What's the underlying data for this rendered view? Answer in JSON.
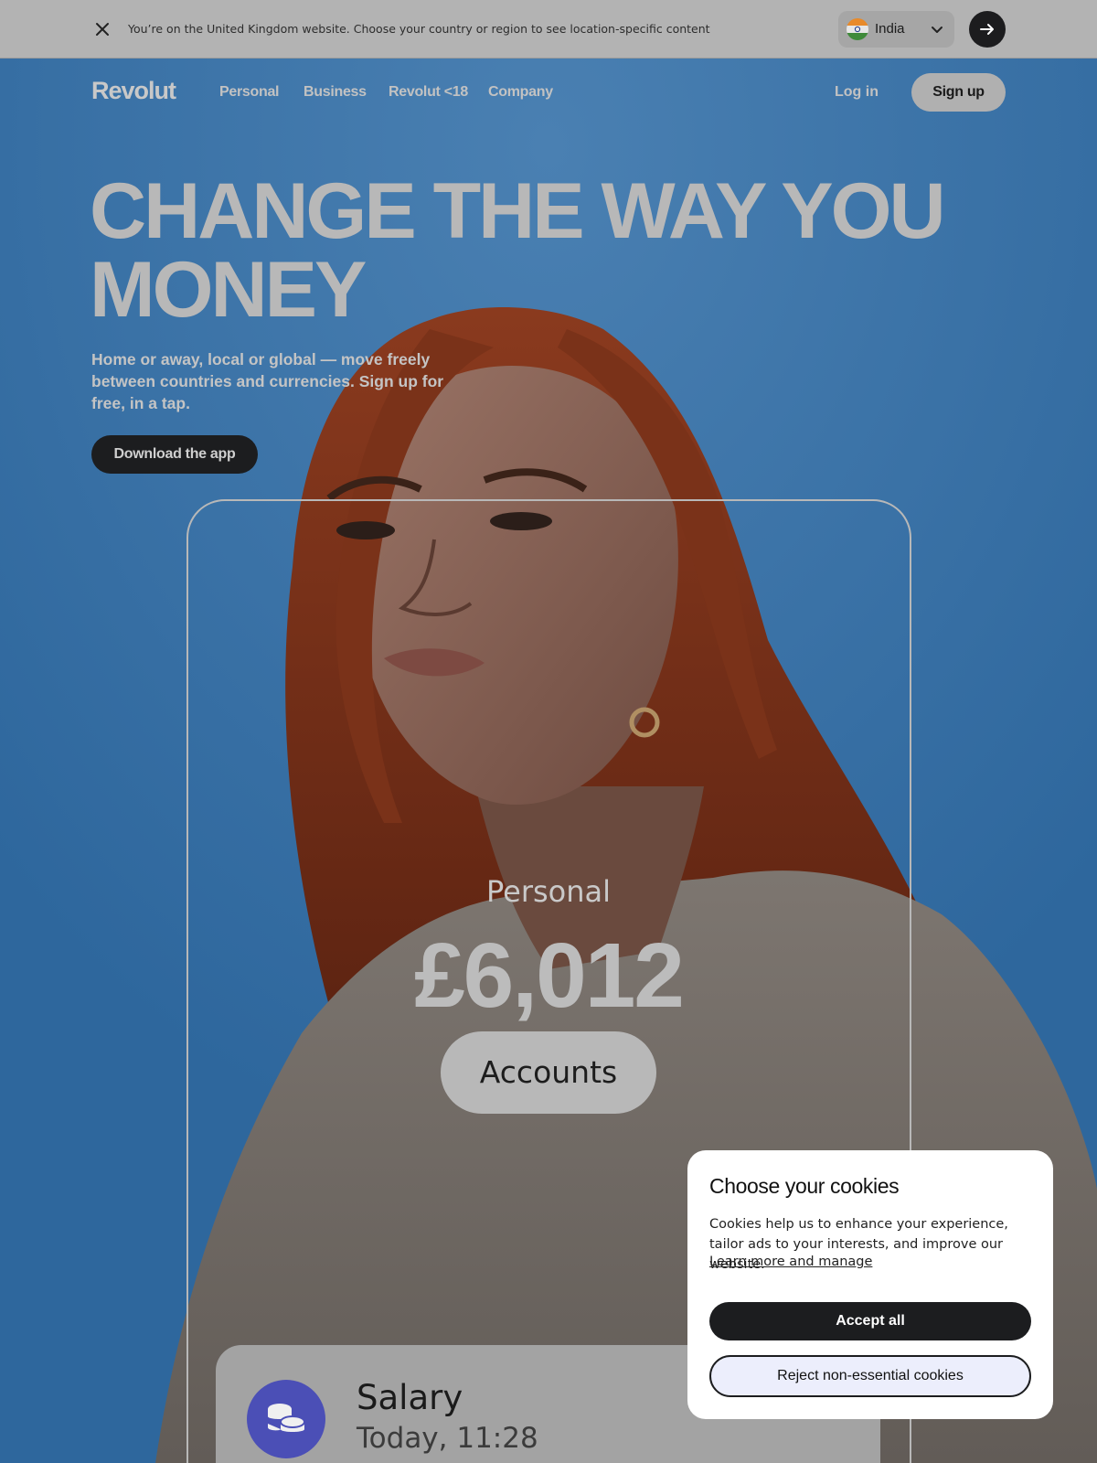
{
  "banner": {
    "message": "You’re on the United Kingdom website. Choose your country or region to see location-specific content",
    "close_icon": "close-icon",
    "country": "India",
    "flag_icon": "india-flag-icon",
    "chevron_icon": "chevron-down-icon",
    "go_icon": "arrow-right-icon"
  },
  "nav": {
    "logo": "Revolut",
    "links": [
      "Personal",
      "Business",
      "Revolut <18",
      "Company"
    ],
    "login": "Log in",
    "signup": "Sign up"
  },
  "hero": {
    "headline_line1": "CHANGE THE WAY YOU",
    "headline_line2": "MONEY",
    "subtext": "Home or away, local or global — move freely between countries and currencies. Sign up for free, in a tap.",
    "download_button": "Download the app"
  },
  "phone": {
    "account_label": "Personal",
    "balance": "£6,012",
    "accounts_button": "Accounts",
    "transaction": {
      "icon": "coins-icon",
      "title": "Salary",
      "time": "Today, 11:28"
    }
  },
  "cookies": {
    "title": "Choose your cookies",
    "body": "Cookies help us to enhance your experience, tailor ads to your interests, and improve our website.",
    "link": "Learn more and manage",
    "accept": "Accept all",
    "reject": "Reject non-essential cookies"
  },
  "colors": {
    "sky": "#3a74a8",
    "overlay": "#b3b3b3",
    "dark_button": "#1c1d1f",
    "salary_icon_bg": "#4b4fb6"
  }
}
